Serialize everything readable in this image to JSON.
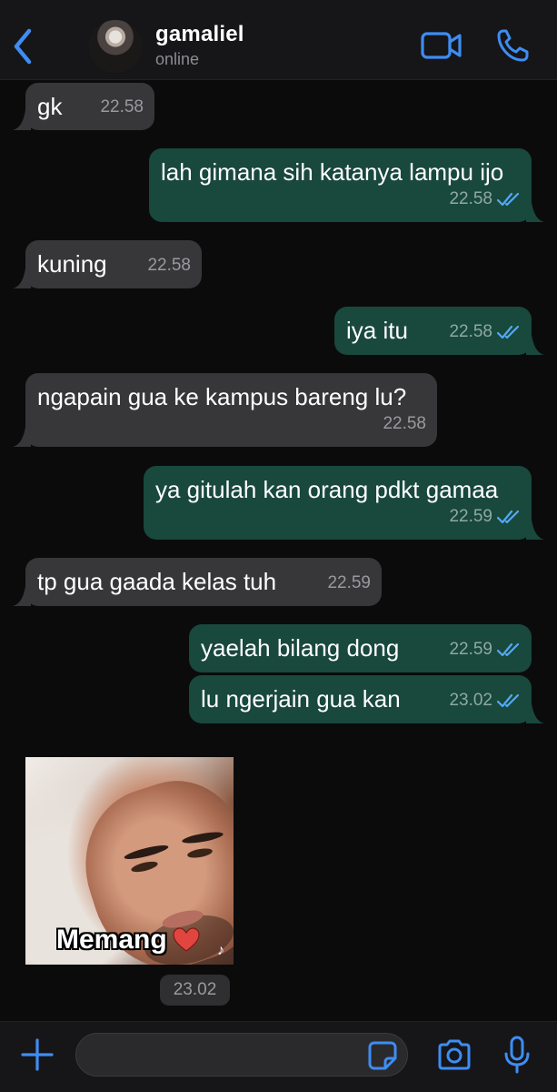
{
  "header": {
    "contact_name": "gamaliel",
    "status": "online",
    "icons": {
      "back": "chevron-left-icon",
      "video": "video-camera-icon",
      "call": "phone-icon"
    }
  },
  "colors": {
    "accent": "#3e8df3",
    "incoming_bubble": "#373739",
    "outgoing_bubble": "#19483d",
    "background": "#0b0b0b",
    "read_tick": "#53a9f3"
  },
  "messages": [
    {
      "direction": "in",
      "text": "gk",
      "time": "22.58"
    },
    {
      "direction": "out",
      "text": "lah gimana sih katanya lampu ijo",
      "time": "22.58",
      "read": true
    },
    {
      "direction": "in",
      "text": "kuning",
      "time": "22.58"
    },
    {
      "direction": "out",
      "text": "iya itu",
      "time": "22.58",
      "read": true
    },
    {
      "direction": "in",
      "text": "ngapain gua ke kampus bareng lu?",
      "time": "22.58"
    },
    {
      "direction": "out",
      "text": "ya gitulah kan orang pdkt gamaa",
      "time": "22.59",
      "read": true
    },
    {
      "direction": "in",
      "text": "tp gua gaada kelas tuh",
      "time": "22.59"
    },
    {
      "direction": "out",
      "text": "yaelah bilang dong",
      "time": "22.59",
      "read": true
    },
    {
      "direction": "out",
      "text": "lu ngerjain gua kan",
      "time": "23.02",
      "read": true
    }
  ],
  "sticker": {
    "caption": "Memang",
    "time": "23.02",
    "icons": {
      "heart": "heart-icon",
      "watermark": "tiktok-icon"
    }
  },
  "input_bar": {
    "placeholder": "",
    "icons": {
      "attach": "plus-icon",
      "sticker": "sticker-icon",
      "camera": "camera-icon",
      "mic": "microphone-icon"
    }
  }
}
